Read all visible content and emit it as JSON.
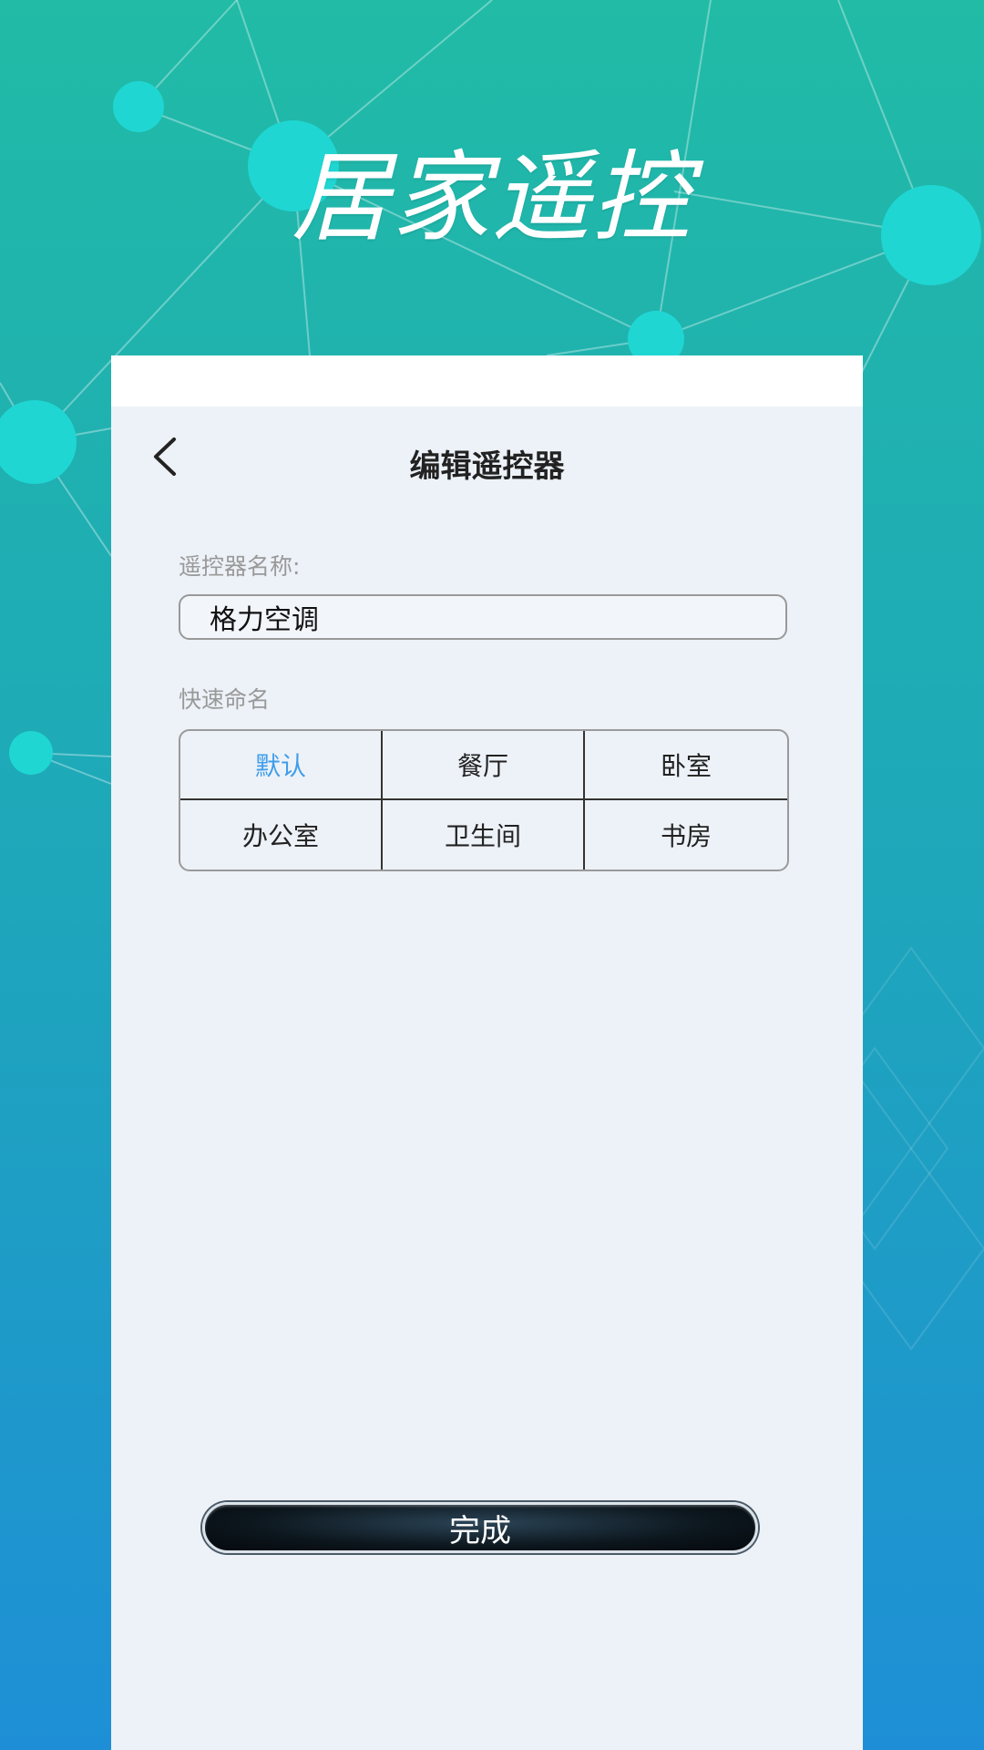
{
  "promo": {
    "title": "居家遥控"
  },
  "header": {
    "title": "编辑遥控器"
  },
  "form": {
    "name_label": "遥控器名称:",
    "name_value": "格力空调",
    "quick_label": "快速命名"
  },
  "quick_names": [
    {
      "label": "默认",
      "selected": true
    },
    {
      "label": "餐厅",
      "selected": false
    },
    {
      "label": "卧室",
      "selected": false
    },
    {
      "label": "办公室",
      "selected": false
    },
    {
      "label": "卫生间",
      "selected": false
    },
    {
      "label": "书房",
      "selected": false
    }
  ],
  "actions": {
    "done_label": "完成"
  },
  "colors": {
    "selected_text": "#3f9dea",
    "background_top": "#21bba6",
    "background_bottom": "#1e8fd6"
  },
  "icons": {
    "back": "chevron-left-icon"
  }
}
